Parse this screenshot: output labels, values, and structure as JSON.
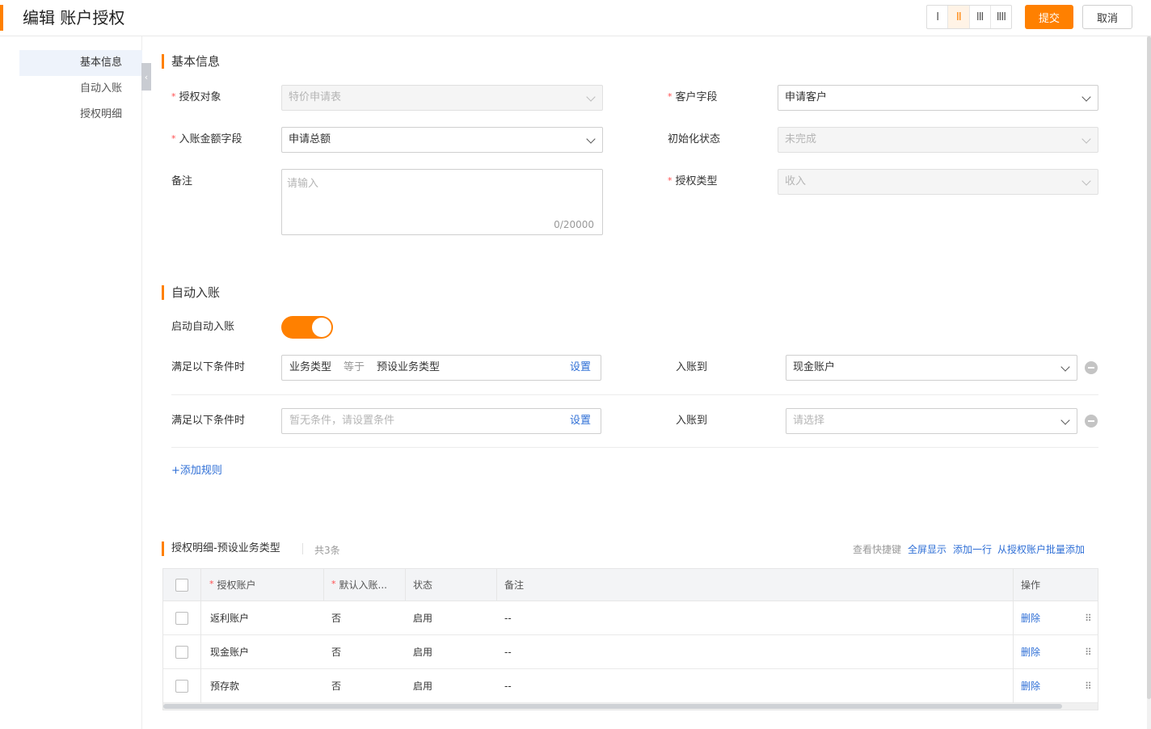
{
  "header": {
    "title": "编辑 账户授权",
    "column_options": [
      "I",
      "II",
      "III",
      "IIII"
    ],
    "active_column_option": 1,
    "submit_label": "提交",
    "cancel_label": "取消"
  },
  "leftnav": {
    "items": [
      {
        "label": "基本信息",
        "active": true
      },
      {
        "label": "自动入账",
        "active": false
      },
      {
        "label": "授权明细",
        "active": false
      }
    ],
    "collapse_glyph": "‹"
  },
  "basic": {
    "section_title": "基本信息",
    "auth_object": {
      "label": "授权对象",
      "required": true,
      "value": "特价申请表",
      "disabled": true
    },
    "customer_field": {
      "label": "客户字段",
      "required": true,
      "value": "申请客户",
      "disabled": false
    },
    "amount_field": {
      "label": "入账金额字段",
      "required": true,
      "value": "申请总额",
      "disabled": false
    },
    "init_status": {
      "label": "初始化状态",
      "required": false,
      "value": "未完成",
      "disabled": true
    },
    "remark": {
      "label": "备注",
      "placeholder": "请输入",
      "count": "0/20000"
    },
    "auth_type": {
      "label": "授权类型",
      "required": true,
      "value": "收入",
      "disabled": true
    }
  },
  "auto": {
    "section_title": "自动入账",
    "enable_label": "启动自动入账",
    "enabled": true,
    "rules": [
      {
        "cond_label": "满足以下条件时",
        "field": "业务类型",
        "operator": "等于",
        "value": "预设业务类型",
        "placeholder": "",
        "set_label": "设置",
        "target_label": "入账到",
        "target_value": "现金账户",
        "target_placeholder": ""
      },
      {
        "cond_label": "满足以下条件时",
        "field": "",
        "operator": "",
        "value": "",
        "placeholder": "暂无条件，请设置条件",
        "set_label": "设置",
        "target_label": "入账到",
        "target_value": "",
        "target_placeholder": "请选择"
      }
    ],
    "add_rule_label": "+添加规则"
  },
  "detail": {
    "section_title": "授权明细-预设业务类型",
    "count_text": "共3条",
    "tools": {
      "shortcut": "查看快捷键",
      "fullscreen": "全屏显示",
      "add_row": "添加一行",
      "batch_add": "从授权账户批量添加"
    },
    "columns": {
      "account": "授权账户",
      "default": "默认入账...",
      "status": "状态",
      "remark": "备注",
      "action": "操作"
    },
    "rows": [
      {
        "account": "返利账户",
        "default": "否",
        "status": "启用",
        "remark": "--",
        "action": "删除"
      },
      {
        "account": "现金账户",
        "default": "否",
        "status": "启用",
        "remark": "--",
        "action": "删除"
      },
      {
        "account": "预存款",
        "default": "否",
        "status": "启用",
        "remark": "--",
        "action": "删除"
      }
    ],
    "drag_glyph": "⠿"
  },
  "colors": {
    "accent": "#ff8000",
    "link": "#2f6fd6",
    "required": "#ff4d4f"
  }
}
